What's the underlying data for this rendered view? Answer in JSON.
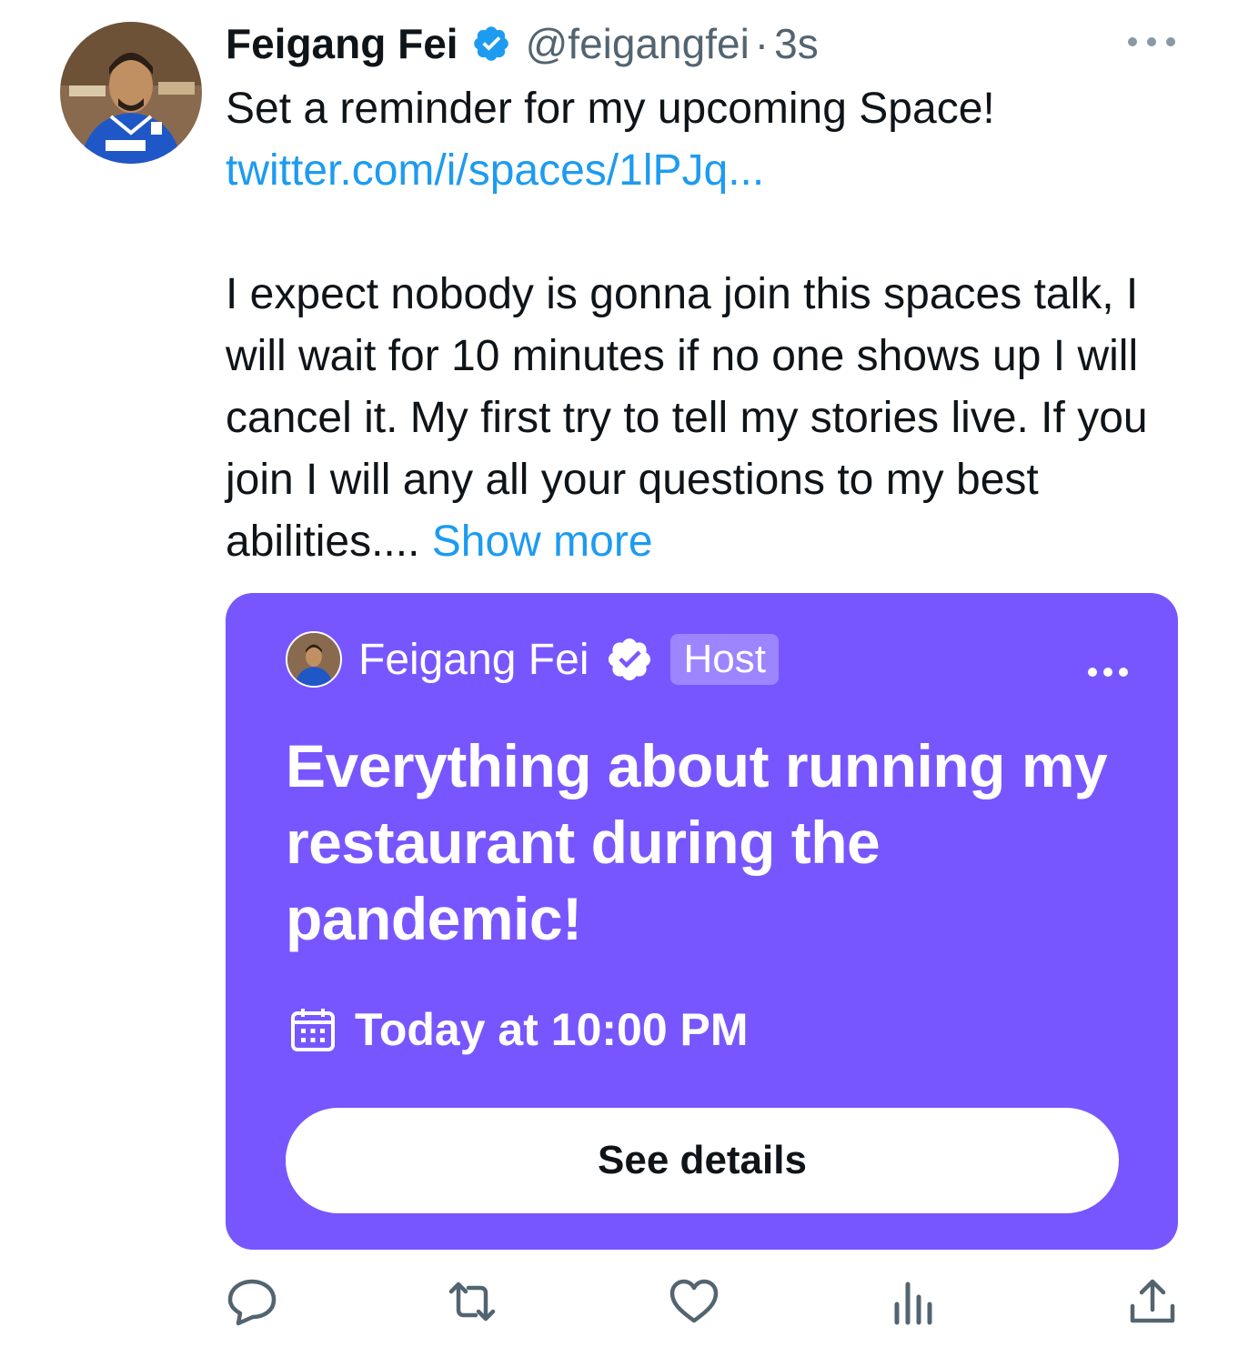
{
  "tweet": {
    "display_name": "Feigang Fei",
    "handle": "@feigangfei",
    "separator": "·",
    "time": "3s",
    "line1": "Set a reminder for my upcoming Space!",
    "link": "twitter.com/i/spaces/1lPJq...",
    "body": "I expect nobody is gonna join this spaces talk, I will wait for 10 minutes if no one shows up I will cancel it. My first try to tell my stories live. If you join I will any all your questions to my best abilities....",
    "show_more": "Show more",
    "more_icon": "more-horizontal-icon",
    "verified_icon": "verified-badge-icon"
  },
  "space_card": {
    "host_name": "Feigang Fei",
    "host_label": "Host",
    "title": "Everything about running my restaurant during the pandemic!",
    "schedule": "Today at 10:00 PM",
    "schedule_icon": "calendar-icon",
    "button_label": "See details",
    "background_color": "#7856ff"
  },
  "actions": {
    "reply_icon": "reply-icon",
    "retweet_icon": "retweet-icon",
    "like_icon": "like-icon",
    "views_icon": "views-icon",
    "share_icon": "share-icon"
  },
  "colors": {
    "link": "#1d9bf0",
    "secondary_text": "#536471",
    "primary_text": "#0f1419",
    "icon_gray": "#536471"
  }
}
